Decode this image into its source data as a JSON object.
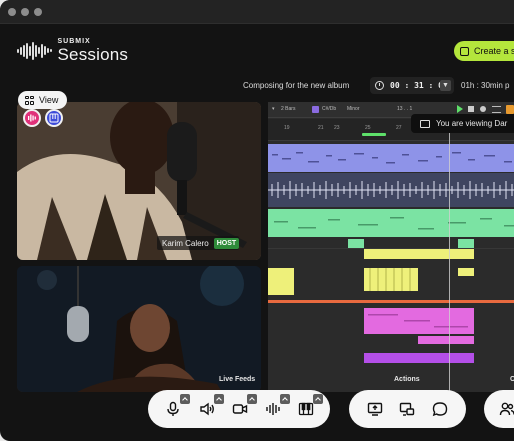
{
  "app": {
    "logo_top": "SUBMIX",
    "logo_main": "Sessions",
    "create_label": "Create a s"
  },
  "session": {
    "title": "Composing for the new album",
    "timer": "00 : 31 : 07",
    "remaining": "01h : 30min p"
  },
  "view_button": {
    "label": "View"
  },
  "videos": [
    {
      "name": "Karim Calero",
      "badge": "HOST"
    }
  ],
  "daw": {
    "toolbar": {
      "bars": "2 Bars",
      "key": "C#/Db",
      "scale": "Minor",
      "time": "13 . . 1"
    },
    "ruler": [
      "19",
      "21",
      "23",
      "25",
      "27",
      "2"
    ],
    "viewing_notice": "You are viewing Dar"
  },
  "sections": {
    "live_feeds": "Live Feeds",
    "actions": "Actions",
    "third": "C"
  },
  "controls": {
    "media": [
      "microphone-icon",
      "speaker-icon",
      "camera-icon",
      "audio-wave-icon",
      "piano-icon"
    ],
    "actions": [
      "share-screen-icon",
      "screen-switch-icon",
      "chat-icon"
    ],
    "people": [
      "people-icon"
    ]
  },
  "colors": {
    "accent_green": "#b4e63c",
    "host_badge": "#2e8b3a",
    "clip_blue": "#8e93e8",
    "clip_green": "#7be3a3",
    "clip_yellow": "#eef07a",
    "clip_magenta": "#e36ae0",
    "clip_purple": "#b44fe8"
  }
}
